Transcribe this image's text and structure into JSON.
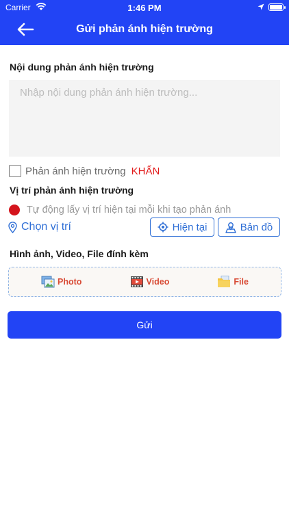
{
  "status_bar": {
    "carrier": "Carrier",
    "time": "1:46 PM"
  },
  "header": {
    "title": "Gửi phản ánh hiện trường",
    "background": "#2244f5"
  },
  "form": {
    "content_label": "Nội dung phản ánh hiện trường",
    "content_placeholder": "Nhập nội dung phản ánh hiện trường...",
    "urgent_label": "Phản ánh hiện trường",
    "urgent_tag": "KHẨN",
    "location_label": "Vị trí phản ánh hiện trường",
    "auto_location_text": "Tự động lấy vị trí hiện tại mỗi khi tạo phản ánh",
    "choose_location": "Chọn vị trí",
    "current_location_button": "Hiện tại",
    "map_button": "Bản đồ",
    "attachments_label": "Hình ảnh, Video, File đính kèm",
    "attachments": {
      "photo": "Photo",
      "video": "Video",
      "file": "File"
    },
    "submit_label": "Gửi"
  },
  "colors": {
    "accent": "#2244f5",
    "link": "#2f6fd6",
    "urgent": "#e21a1a",
    "radio_selected": "#d4141c"
  }
}
